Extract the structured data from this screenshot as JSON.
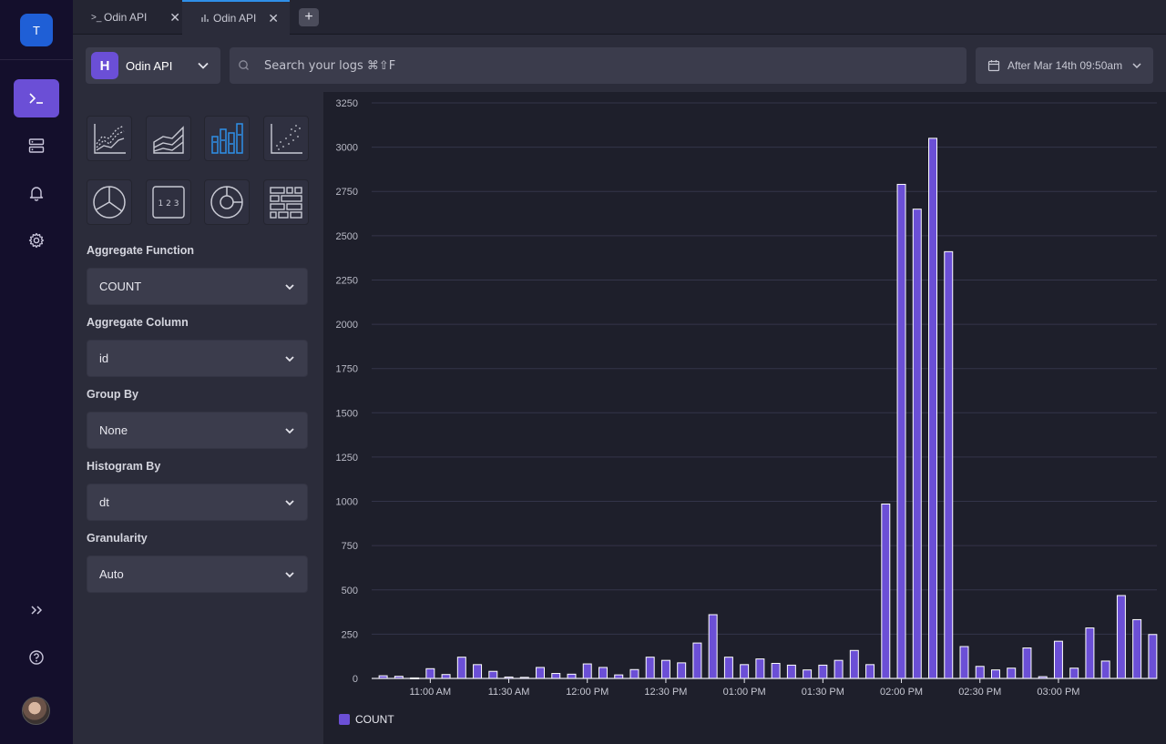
{
  "rail": {
    "team_initial": "T",
    "nav_icons": [
      "terminal-icon",
      "server-icon",
      "bell-icon",
      "gear-icon"
    ],
    "bottom_icons": [
      "expand-icon",
      "help-icon"
    ]
  },
  "tabs": [
    {
      "label": "Odin API",
      "icon": "terminal-icon",
      "active": false
    },
    {
      "label": "Odin API",
      "icon": "bar-chart-icon",
      "active": true
    }
  ],
  "add_tab_label": "+",
  "toolbar": {
    "source_name": "Odin API",
    "source_logo": "H",
    "search_placeholder": "Search your logs ⌘⇧F",
    "date_range": "After Mar 14th 09:50am"
  },
  "panel": {
    "chart_types": [
      "line-chart",
      "area-chart",
      "bar-chart",
      "scatter-chart",
      "pie-chart",
      "number-chart",
      "donut-chart",
      "table-chart"
    ],
    "selected_chart_type": "bar-chart",
    "fields": [
      {
        "label": "Aggregate Function",
        "value": "COUNT"
      },
      {
        "label": "Aggregate Column",
        "value": "id"
      },
      {
        "label": "Group By",
        "value": "None"
      },
      {
        "label": "Histogram By",
        "value": "dt"
      },
      {
        "label": "Granularity",
        "value": "Auto"
      }
    ]
  },
  "colors": {
    "accent": "#6b4fd6",
    "tab_active": "#2f8fe8",
    "selected_chart_icon": "#2f8fe8"
  },
  "chart_data": {
    "type": "bar",
    "series": [
      {
        "name": "COUNT",
        "values": [
          15,
          12,
          3,
          55,
          22,
          120,
          78,
          40,
          8,
          6,
          62,
          28,
          24,
          82,
          62,
          20,
          50,
          120,
          102,
          88,
          200,
          360,
          120,
          78,
          110,
          85,
          75,
          48,
          75,
          102,
          158,
          78,
          985,
          2790,
          2650,
          3050,
          2410,
          180,
          68,
          48,
          58,
          172,
          10,
          210,
          58,
          285,
          98,
          468,
          332,
          248
        ]
      }
    ],
    "x_ticks": [
      "11:00 AM",
      "11:30 AM",
      "12:00 PM",
      "12:30 PM",
      "01:00 PM",
      "01:30 PM",
      "02:00 PM",
      "02:30 PM",
      "03:00 PM"
    ],
    "y_ticks": [
      "0",
      "250",
      "500",
      "750",
      "1000",
      "1250",
      "1500",
      "1750",
      "2000",
      "2250",
      "2500",
      "2750",
      "3000",
      "3250"
    ],
    "ylim": [
      0,
      3250
    ],
    "grid": true,
    "legend": "bottom-left"
  }
}
